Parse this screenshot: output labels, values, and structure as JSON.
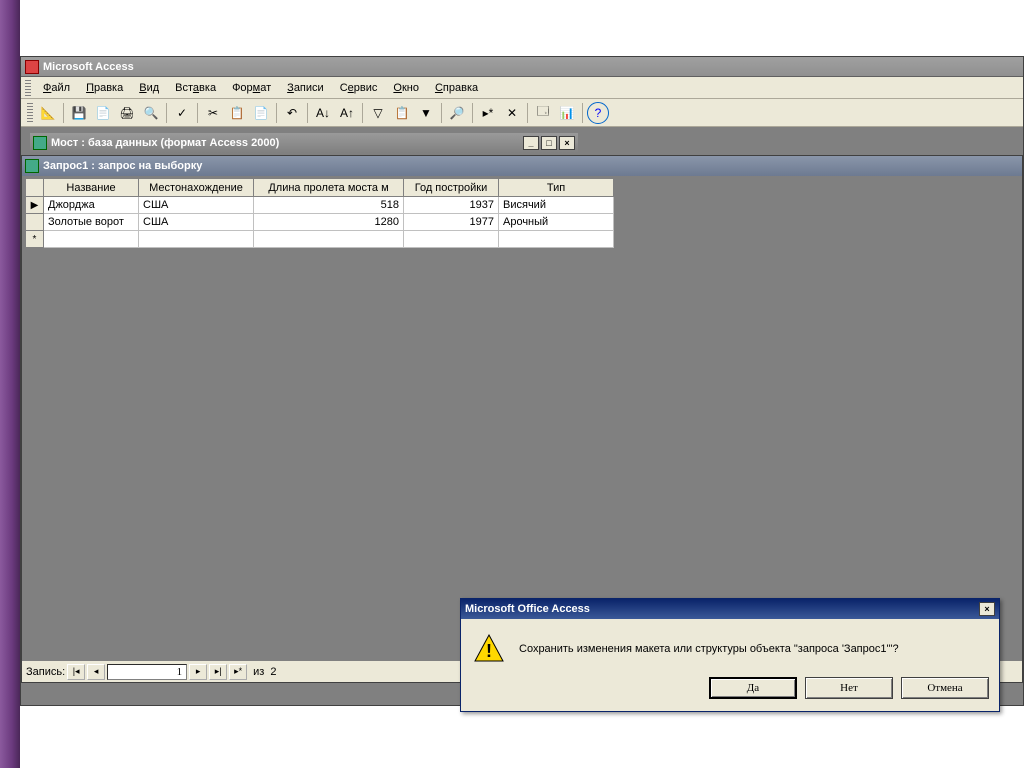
{
  "app": {
    "title": "Microsoft Access"
  },
  "menu": {
    "file": "Файл",
    "edit": "Правка",
    "view": "Вид",
    "insert": "Вставка",
    "format": "Формат",
    "records": "Записи",
    "tools": "Сервис",
    "window": "Окно",
    "help": "Справка"
  },
  "db_window": {
    "title": "Мост : база данных (формат Access 2000)"
  },
  "query_window": {
    "title": "Запрос1 : запрос на выборку"
  },
  "columns": {
    "c0": "Название",
    "c1": "Местонахождение",
    "c2": "Длина пролета моста м",
    "c3": "Год постройки",
    "c4": "Тип"
  },
  "rows": [
    {
      "c0": "Джорджа",
      "c1": "США",
      "c2": "518",
      "c3": "1937",
      "c4": "Висячий"
    },
    {
      "c0": "Золотые ворот",
      "c1": "США",
      "c2": "1280",
      "c3": "1977",
      "c4": "Арочный"
    }
  ],
  "nav": {
    "label": "Запись:",
    "current": "1",
    "of_label": "из",
    "total": "2"
  },
  "dialog": {
    "title": "Microsoft Office Access",
    "message": "Сохранить изменения макета или структуры объекта \"запроса 'Запрос1'\"?",
    "yes": "Да",
    "no": "Нет",
    "cancel": "Отмена"
  }
}
